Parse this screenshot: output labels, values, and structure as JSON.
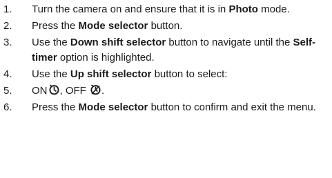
{
  "steps": [
    {
      "number": "1.",
      "pre": "Turn the camera on and ensure that it is in ",
      "bold": "Photo",
      "post": " mode."
    },
    {
      "number": "2.",
      "pre": "Press the ",
      "bold": "Mode selector",
      "post": " button."
    },
    {
      "number": "3.",
      "pre": "Use the ",
      "bold": "Down shift selector",
      "mid": " button to navigate until the ",
      "bold2": "Self-timer",
      "post": " option is highlighted."
    },
    {
      "number": "4.",
      "pre": "Use the ",
      "bold": "Up shift selector",
      "post": " button to select:"
    },
    {
      "number": "5.",
      "on_label": "ON",
      "on_icon": "self-timer-on-icon",
      "separator": ", ",
      "off_label": "OFF",
      "off_icon": "self-timer-off-icon",
      "post": "."
    },
    {
      "number": "6.",
      "pre": "Press the ",
      "bold": "Mode selector",
      "post": " button to confirm and exit the menu."
    }
  ]
}
